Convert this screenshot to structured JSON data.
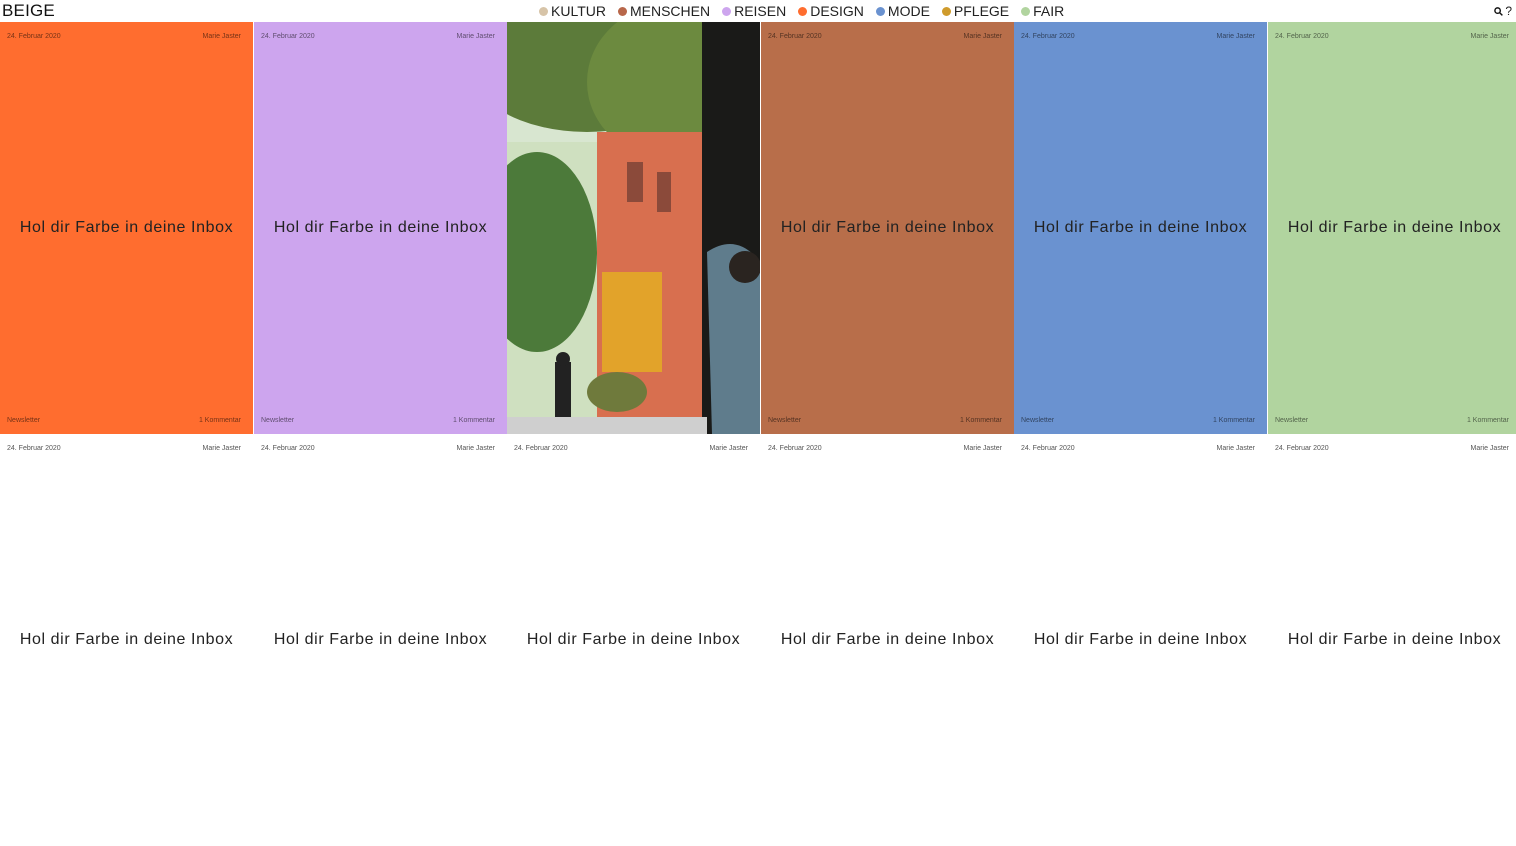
{
  "header": {
    "logo": "BEIGE",
    "nav": [
      {
        "label": "KULTUR",
        "color": "#d7c4a8"
      },
      {
        "label": "MENSCHEN",
        "color": "#b8674a"
      },
      {
        "label": "REISEN",
        "color": "#cda5ee"
      },
      {
        "label": "DESIGN",
        "color": "#ff6d2f"
      },
      {
        "label": "MODE",
        "color": "#6a92d0"
      },
      {
        "label": "PFLEGE",
        "color": "#cf9b2c"
      },
      {
        "label": "FAIR",
        "color": "#b1d49f"
      }
    ],
    "help_label": "?"
  },
  "cards": [
    {
      "date": "24. Februar 2020",
      "author": "Marie Jaster",
      "title": "Hol dir Farbe in deine Inbox",
      "category": "Newsletter",
      "comments": "1 Kommentar",
      "bg": "#ff6d2f"
    },
    {
      "date": "24. Februar 2020",
      "author": "Marie Jaster",
      "title": "Hol dir Farbe in deine Inbox",
      "category": "Newsletter",
      "comments": "1 Kommentar",
      "bg": "#cda5ee"
    },
    {
      "date": "",
      "author": "",
      "title": "",
      "category": "",
      "comments": "",
      "bg": "photo"
    },
    {
      "date": "24. Februar 2020",
      "author": "Marie Jaster",
      "title": "Hol dir Farbe in deine Inbox",
      "category": "Newsletter",
      "comments": "1 Kommentar",
      "bg": "#b86e4a"
    },
    {
      "date": "24. Februar 2020",
      "author": "Marie Jaster",
      "title": "Hol dir Farbe in deine Inbox",
      "category": "Newsletter",
      "comments": "1 Kommentar",
      "bg": "#6a92d0"
    },
    {
      "date": "24. Februar 2020",
      "author": "Marie Jaster",
      "title": "Hol dir Farbe in deine Inbox",
      "category": "Newsletter",
      "comments": "1 Kommentar",
      "bg": "#b1d49f"
    },
    {
      "date": "24. Februar 2020",
      "author": "Marie Jaster",
      "title": "Hol dir Farbe in deine Inbox",
      "bg": "#ffffff"
    },
    {
      "date": "24. Februar 2020",
      "author": "Marie Jaster",
      "title": "Hol dir Farbe in deine Inbox",
      "bg": "#ffffff"
    },
    {
      "date": "24. Februar 2020",
      "author": "Marie Jaster",
      "title": "Hol dir Farbe in deine Inbox",
      "bg": "#ffffff"
    },
    {
      "date": "24. Februar 2020",
      "author": "Marie Jaster",
      "title": "Hol dir Farbe in deine Inbox",
      "bg": "#ffffff"
    },
    {
      "date": "24. Februar 2020",
      "author": "Marie Jaster",
      "title": "Hol dir Farbe in deine Inbox",
      "bg": "#ffffff"
    },
    {
      "date": "24. Februar 2020",
      "author": "Marie Jaster",
      "title": "Hol dir Farbe in deine Inbox",
      "bg": "#ffffff"
    }
  ]
}
